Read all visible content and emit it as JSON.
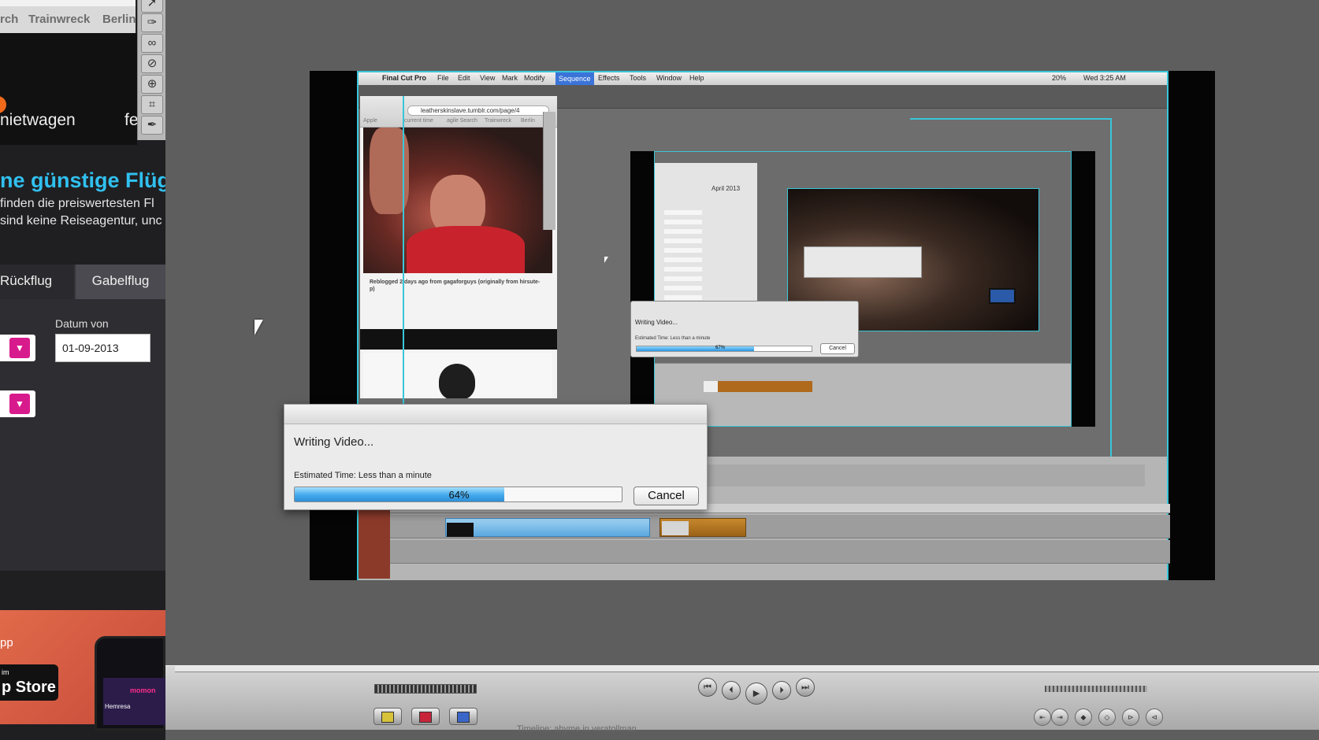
{
  "browser": {
    "tabs": [
      "rch",
      "Trainwreck",
      "Berlin"
    ],
    "nav_left": "nietwagen",
    "nav_right": "fe",
    "promo_heading": "ne günstige Flüg",
    "promo_line1": "finden die preiswertesten Fl",
    "promo_line2": "sind keine Reiseagentur, unc",
    "trip_tabs": [
      "Rückflug",
      "Gabelflug"
    ],
    "date_label": "Datum von",
    "date_value": "01-09-2013",
    "app_label": "pp",
    "store_small": "im",
    "store_big": "p Store",
    "phone_brand": "momon",
    "phone_user": "Hemresa"
  },
  "tools": [
    "pointer-icon",
    "pen-icon",
    "glasses-icon",
    "razor-icon",
    "zoom-icon",
    "crop-icon",
    "pen-nib-icon"
  ],
  "fcp_menu": {
    "app": "Final Cut Pro",
    "items": [
      "File",
      "Edit",
      "View",
      "Mark",
      "Modify",
      "Sequence",
      "Effects",
      "Tools",
      "Window",
      "Help"
    ],
    "active": "Sequence",
    "clock": "Wed 3:25 AM",
    "battery": "20%"
  },
  "inner_browser": {
    "url": "leatherskinslave.tumblr.com/page/4",
    "bookmarks": [
      "Apple",
      "current time",
      "agile Search",
      "Trainwreck",
      "Berlin"
    ],
    "caption": "Reblogged 2 days ago from gagaforguys (originally from hirsute-p)"
  },
  "nested": {
    "month": "April 2013",
    "dialog_title": "Writing Video...",
    "dialog_eta": "Estimated Time: Less than a minute",
    "dialog_percent": "67%",
    "dialog_progress": 0.67,
    "dialog_cancel": "Cancel"
  },
  "dialog": {
    "title": "Writing Video...",
    "eta": "Estimated Time: Less than a minute",
    "percent": "64%",
    "progress": 0.64,
    "cancel": "Cancel"
  },
  "bottom": {
    "timeline_label": "Timeline: ahyme in veratollman"
  },
  "colors": {
    "accent_blue": "#39c6d8",
    "promo_blue": "#30c0ef",
    "dropdown_pink": "#d81b8c",
    "progress_blue": "#43a9ec"
  }
}
